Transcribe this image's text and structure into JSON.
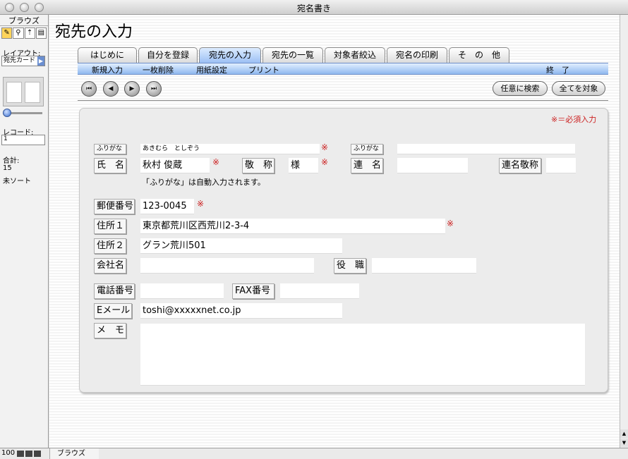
{
  "window": {
    "title": "宛名書き"
  },
  "status": {
    "mode": "ブラウズ",
    "tools": [
      "✎",
      "⚲",
      "⇡",
      "▤"
    ],
    "layout_label": "レイアウト:",
    "layout_value": "宛先カード",
    "record_label": "レコード:",
    "record_value": "1",
    "total_label": "合計:",
    "total_value": "15",
    "sort_status": "未ソート"
  },
  "page": {
    "title": "宛先の入力"
  },
  "tabs": [
    {
      "label": "はじめに"
    },
    {
      "label": "自分を登録"
    },
    {
      "label": "宛先の入力"
    },
    {
      "label": "宛先の一覧"
    },
    {
      "label": "対象者絞込"
    },
    {
      "label": "宛名の印刷"
    },
    {
      "label": "そ　の　他"
    }
  ],
  "subbar": {
    "new_record": "新規入力",
    "delete_record": "一枚削除",
    "page_setup": "用紙設定",
    "print": "プリント",
    "quit": "終　了"
  },
  "nav": {
    "first": "⏮",
    "prev": "◀",
    "next": "▶",
    "last": "⏭",
    "find_label": "任意に検索",
    "show_all_label": "全てを対象"
  },
  "form": {
    "required_note": "※＝必須入力",
    "required_mark": "※",
    "furigana_label": "ふりがな",
    "furigana_value": "あきむら　としぞう",
    "furigana2_label": "ふりがな",
    "furigana2_value": "",
    "name_label": "氏　名",
    "name_value": "秋村 俊蔵",
    "honorific_label": "敬　称",
    "honorific_value": "様",
    "joint_name_label": "連　名",
    "joint_name_value": "",
    "joint_honorific_label": "連名敬称",
    "joint_honorific_value": "",
    "furigana_hint": "「ふりがな」は自動入力されます。",
    "zip_label": "郵便番号",
    "zip_value": "123-0045",
    "address1_label": "住所１",
    "address1_value": "東京都荒川区西荒川2-3-4",
    "address2_label": "住所２",
    "address2_value": "グラン荒川501",
    "company_label": "会社名",
    "company_value": "",
    "position_label": "役　職",
    "position_value": "",
    "phone_label": "電話番号",
    "phone_value": "",
    "fax_label": "FAX番号",
    "fax_value": "",
    "email_label": "Eメール",
    "email_value": "toshi@xxxxxnet.co.jp",
    "memo_label": "メ　モ",
    "memo_value": ""
  },
  "bottom": {
    "zoom": "100",
    "mode": "ブラウズ"
  }
}
